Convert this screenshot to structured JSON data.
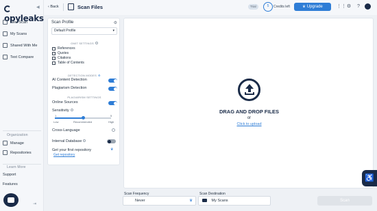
{
  "app": {
    "logo": "Copyleaks"
  },
  "sidebar": {
    "items": [
      {
        "label": "New Scan",
        "icon": "new-scan-icon"
      },
      {
        "label": "My Scans",
        "icon": "scans-icon"
      },
      {
        "label": "Shared With Me",
        "icon": "shared-icon"
      },
      {
        "label": "Text Compare",
        "icon": "compare-icon"
      }
    ],
    "org_heading": "Organization",
    "org_items": [
      {
        "label": "Manage"
      },
      {
        "label": "Repositories"
      }
    ],
    "learn_heading": "Learn More",
    "learn_items": [
      {
        "label": "Support"
      },
      {
        "label": "Features"
      }
    ]
  },
  "header": {
    "back_label": "Back",
    "title": "Scan Files",
    "trial_badge": "Trial",
    "credits_value": "5",
    "credits_label": "Credits left",
    "upgrade_label": "Upgrade"
  },
  "profile": {
    "title": "Scan Profile",
    "selected": "Default Profile",
    "omit_heading": "OMIT SETTINGS",
    "omit_items": [
      "References",
      "Quotes",
      "Citations",
      "Table of Contents"
    ],
    "detection_heading": "DETECTION MODES",
    "ai_label": "AI Content Detection",
    "plag_label": "Plagiarism Detection",
    "plag_settings_heading": "PLAGIARISM SETTINGS",
    "online_label": "Online Sources",
    "sensitivity_label": "Sensitivity",
    "sensitivity": {
      "min": "1",
      "max": "5",
      "low": "Low",
      "recommended": "Recommended",
      "high": "High",
      "value": 3
    },
    "cross_language_label": "Cross-Language",
    "internal_db_label": "Internal Database",
    "repo_label": "Get your first repository",
    "repo_link": "Get repository"
  },
  "toggles": {
    "ai": true,
    "plagiarism": true,
    "online": true,
    "internal_db": false
  },
  "dropzone": {
    "title": "DRAG AND DROP FILES",
    "or": "or",
    "link": "Click to upload"
  },
  "footer": {
    "frequency_label": "Scan Frequency",
    "frequency_value": "Never",
    "destination_label": "Scan Destination",
    "destination_value": "My Scans",
    "scan_label": "Scan"
  },
  "colors": {
    "accent": "#2e7dd6",
    "navy": "#1a2b48"
  }
}
